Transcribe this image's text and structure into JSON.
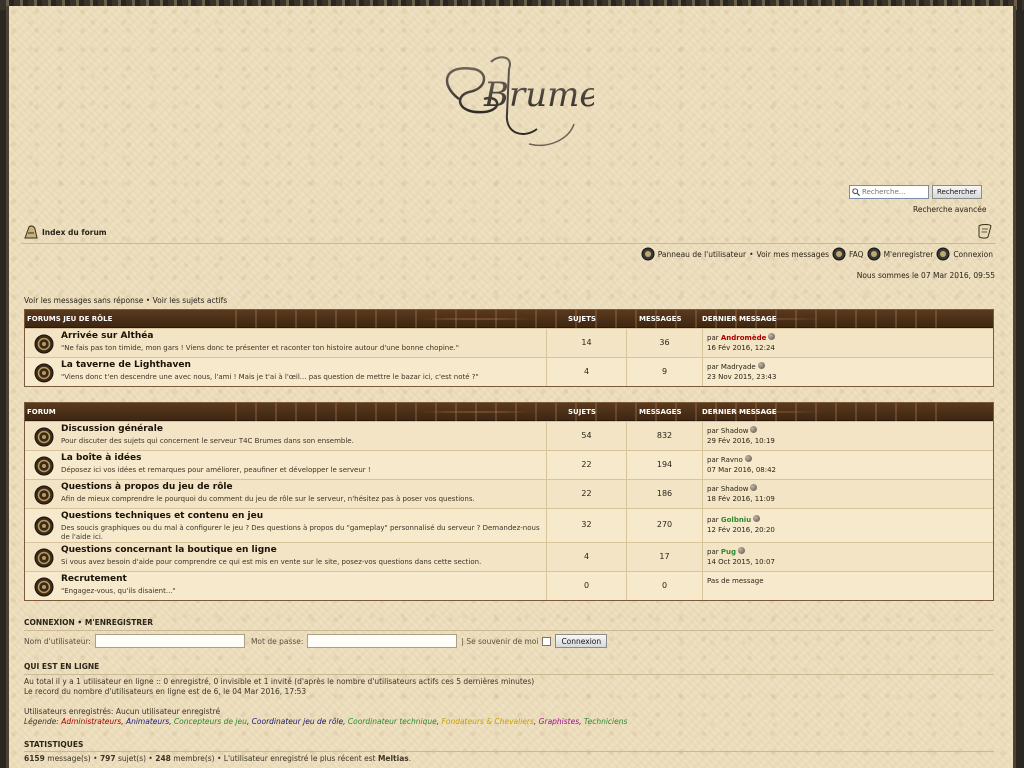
{
  "header": {
    "logo_text": "Brumes",
    "search_placeholder": "Recherche…",
    "search_button": "Rechercher",
    "advanced_search": "Recherche avancée"
  },
  "nav": {
    "breadcrumb": "Index du forum",
    "user_panel": "Panneau de l'utilisateur",
    "sep": "•",
    "my_messages": "Voir mes messages",
    "faq": "FAQ",
    "register": "M'enregistrer",
    "login": "Connexion",
    "datetime": "Nous sommes le 07 Mar 2016, 09:55",
    "unanswered": "Voir les messages sans réponse",
    "active": "Voir les sujets actifs"
  },
  "columns": {
    "topics": "SUJETS",
    "messages": "MESSAGES",
    "last": "DERNIER MESSAGE"
  },
  "categories": [
    {
      "title": "FORUMS JEU DE RÔLE",
      "forums": [
        {
          "title": "Arrivée sur Althéa",
          "desc": "\"Ne fais pas ton timide, mon gars ! Viens donc te présenter et raconter ton histoire autour d'une bonne chopine.\"",
          "topics": "14",
          "messages": "36",
          "by": "par",
          "author": "Andromède",
          "author_color": "#aa0000",
          "date": "16 Fév 2016, 12:24"
        },
        {
          "title": "La taverne de Lighthaven",
          "desc": "\"Viens donc t'en descendre une avec nous, l'ami ! Mais je t'ai à l'œil... pas question de mettre le bazar ici, c'est noté ?\"",
          "topics": "4",
          "messages": "9",
          "by": "par",
          "author": "Madryade",
          "author_color": "#2a2419",
          "date": "23 Nov 2015, 23:43"
        }
      ]
    },
    {
      "title": "FORUM",
      "forums": [
        {
          "title": "Discussion générale",
          "desc": "Pour discuter des sujets qui concernent le serveur T4C Brumes dans son ensemble.",
          "topics": "54",
          "messages": "832",
          "by": "par",
          "author": "Shadow",
          "author_color": "#2a2419",
          "date": "29 Fév 2016, 10:19"
        },
        {
          "title": "La boîte à idées",
          "desc": "Déposez ici vos idées et remarques pour améliorer, peaufiner et développer le serveur !",
          "topics": "22",
          "messages": "194",
          "by": "par",
          "author": "Ravno",
          "author_color": "#2a2419",
          "date": "07 Mar 2016, 08:42"
        },
        {
          "title": "Questions à propos du jeu de rôle",
          "desc": "Afin de mieux comprendre le pourquoi du comment du jeu de rôle sur le serveur, n'hésitez pas à poser vos questions.",
          "topics": "22",
          "messages": "186",
          "by": "par",
          "author": "Shadow",
          "author_color": "#2a2419",
          "date": "18 Fév 2016, 11:09"
        },
        {
          "title": "Questions techniques et contenu en jeu",
          "desc": "Des soucis graphiques ou du mal à configurer le jeu ? Des questions à propos du \"gameplay\" personnalisé du serveur ? Demandez-nous de l'aide ici.",
          "topics": "32",
          "messages": "270",
          "by": "par",
          "author": "Golbniu",
          "author_color": "#2f8a2f",
          "date": "12 Fév 2016, 20:20"
        },
        {
          "title": "Questions concernant la boutique en ligne",
          "desc": "Si vous avez besoin d'aide pour comprendre ce qui est mis en vente sur le site, posez-vos questions dans cette section.",
          "topics": "4",
          "messages": "17",
          "by": "par",
          "author": "Pug",
          "author_color": "#2f8a2f",
          "date": "14 Oct 2015, 10:07"
        },
        {
          "title": "Recrutement",
          "desc": "\"Engagez-vous, qu'ils disaient...\"",
          "topics": "0",
          "messages": "0",
          "no_message": "Pas de message"
        }
      ]
    }
  ],
  "login": {
    "title": "Connexion",
    "register": "M'enregistrer",
    "sep": "•",
    "username_label": "Nom d'utilisateur:",
    "password_label": "Mot de passe:",
    "remember": "| Se souvenir de moi",
    "button": "Connexion"
  },
  "online": {
    "title": "Qui est en ligne",
    "line1": "Au total il y a 1 utilisateur en ligne :: 0 enregistré, 0 invisible et 1 invité (d'après le nombre d'utilisateurs actifs ces 5 dernières minutes)",
    "line2": "Le record du nombre d'utilisateurs en ligne est de 6, le 04 Mar 2016, 17:53",
    "registered": "Utilisateurs enregistrés: Aucun utilisateur enregistré",
    "legend_label": "Légende:",
    "legend": [
      {
        "name": "Administrateurs",
        "color": "#aa0000"
      },
      {
        "name": "Animateurs",
        "color": "#1a1a8a"
      },
      {
        "name": "Concepteurs de jeu",
        "color": "#2f8a2f"
      },
      {
        "name": "Coordinateur jeu de rôle",
        "color": "#1a1a6a"
      },
      {
        "name": "Coordinateur technique",
        "color": "#2f8a2f"
      },
      {
        "name": "Fondateurs & Chevaliers",
        "color": "#c8a000"
      },
      {
        "name": "Graphistes",
        "color": "#a01090"
      },
      {
        "name": "Techniciens",
        "color": "#2f8a2f"
      }
    ]
  },
  "stats": {
    "title": "Statistiques",
    "messages": "6159",
    "messages_label": "message(s)",
    "topics": "797",
    "topics_label": "sujet(s)",
    "members": "248",
    "members_label": "membre(s)",
    "newest_label": "L'utilisateur enregistré le plus récent est",
    "newest": "Meltias"
  }
}
